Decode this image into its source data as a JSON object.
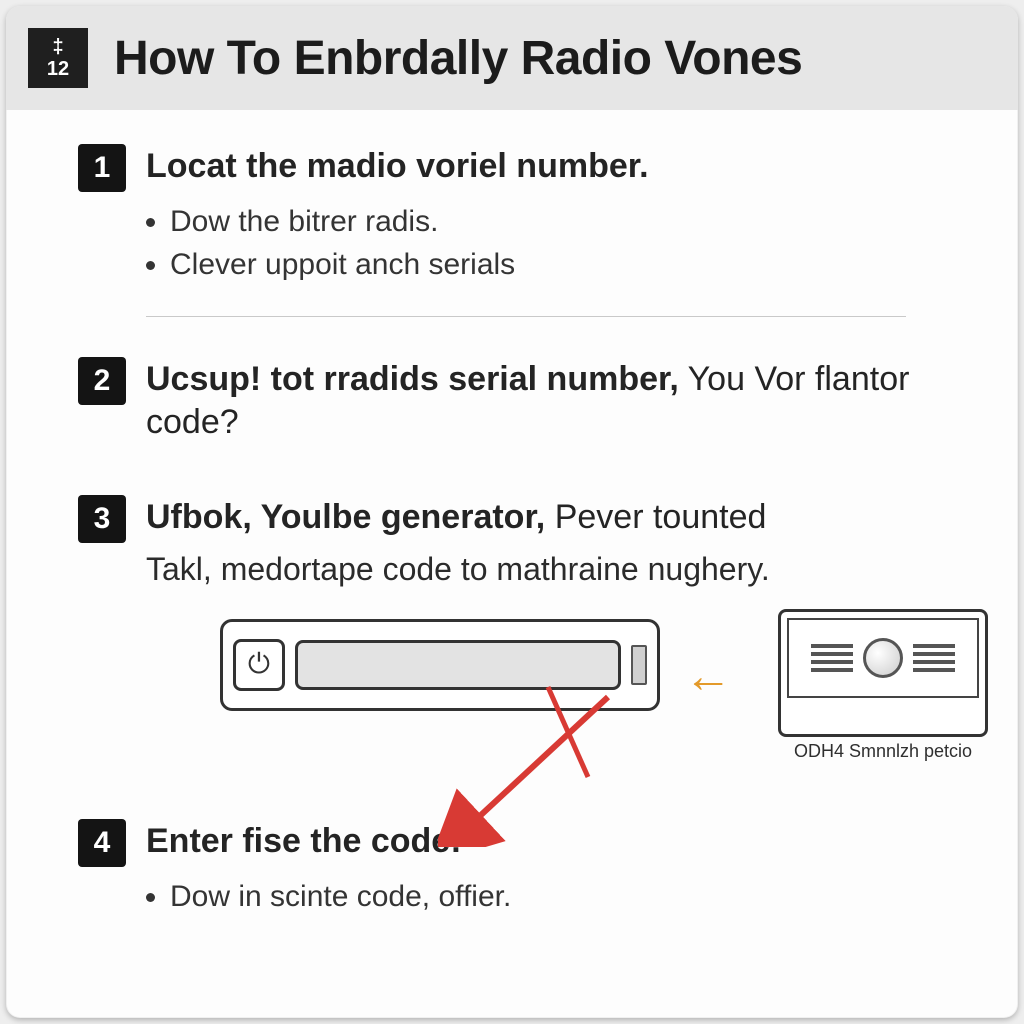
{
  "header": {
    "badge_glyph": "‡",
    "badge_number": "12",
    "title": "How To Enbrdally Radio Vones"
  },
  "steps": [
    {
      "num": "1",
      "title_bold": "Locat the madio voriel number.",
      "title_rest": "",
      "bullets": [
        "Dow the bitrer radis.",
        "Clever uppoit anch serials"
      ]
    },
    {
      "num": "2",
      "title_bold": "Ucsup! tot rradids serial number,",
      "title_rest": " You Vor flantor code?"
    },
    {
      "num": "3",
      "title_bold": "Ufbok, Youlbe generator,",
      "title_rest": " Pever tounted",
      "body": "Takl, medortape code to mathraine nughery."
    },
    {
      "num": "4",
      "title_bold": "Enter fise the code:",
      "title_rest": "",
      "bullets": [
        "Dow in scinte code, offier."
      ]
    }
  ],
  "diagram": {
    "power_glyph": "⏻",
    "arrow_left_glyph": "←",
    "caption": "ODH4 Smnnlzh petcio"
  }
}
